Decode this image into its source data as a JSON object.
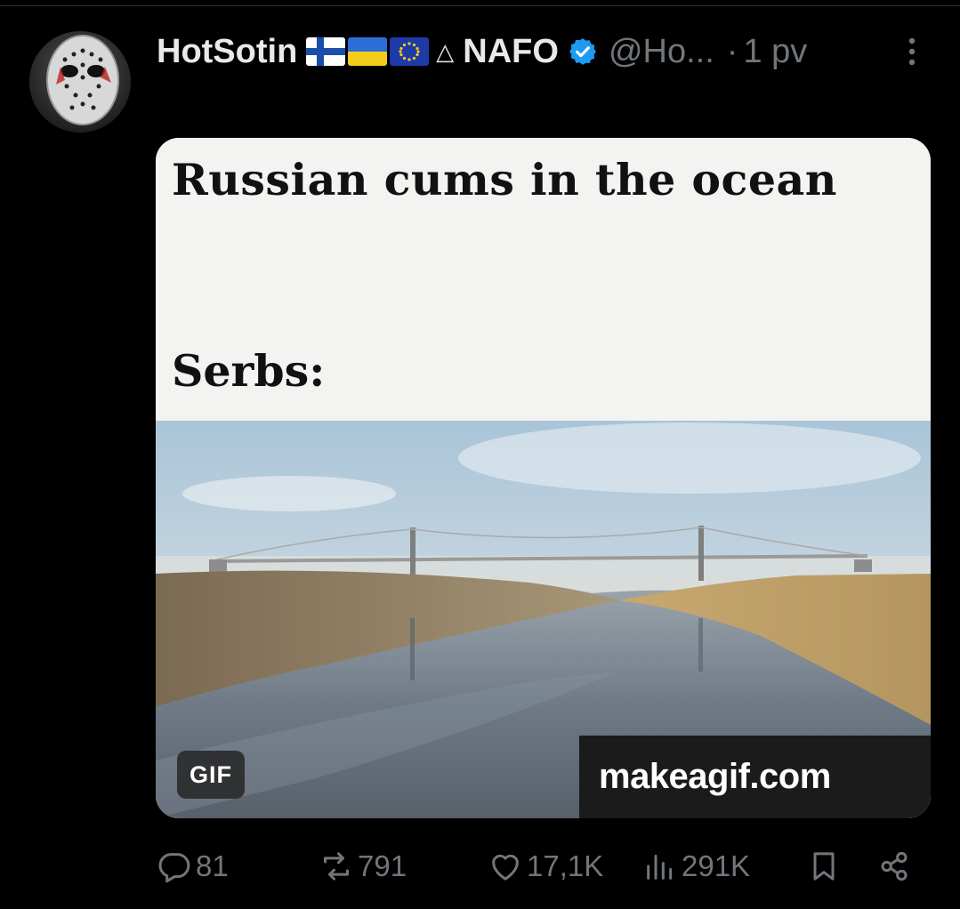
{
  "post": {
    "author_name": "HotSotin",
    "flags": [
      "finland-flag",
      "ukraine-flag",
      "eu-flag"
    ],
    "triangle_glyph": "△",
    "affiliation": "NAFO",
    "verified": true,
    "handle": "@Ho...",
    "separator": "·",
    "time": "1 pv",
    "media": {
      "caption_top": "Russian cums in the ocean",
      "caption_bottom": "Serbs:",
      "badge": "GIF",
      "watermark": "makeagif.com"
    },
    "actions": {
      "replies": "81",
      "reposts": "791",
      "likes": "17,1K",
      "views": "291K"
    }
  },
  "colors": {
    "background": "#000000",
    "text_primary": "#e7e9ea",
    "text_secondary": "#71767b",
    "verified_blue": "#1d9bf0"
  },
  "icons": [
    "more-icon",
    "reply-icon",
    "repost-icon",
    "like-icon",
    "views-icon",
    "bookmark-icon",
    "share-icon",
    "verified-icon"
  ]
}
